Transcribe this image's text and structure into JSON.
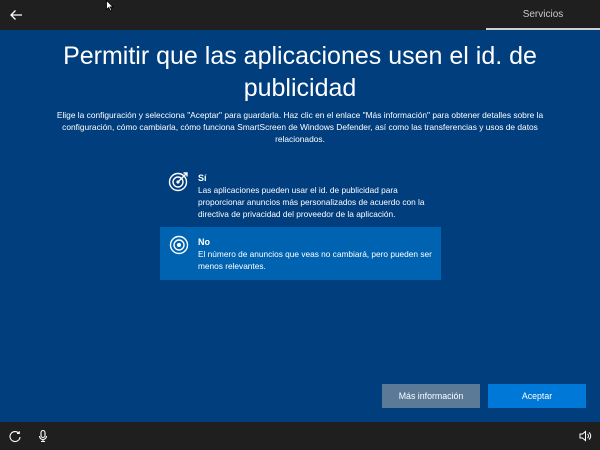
{
  "header": {
    "back_icon": "back-arrow-icon",
    "tab_label": "Servicios"
  },
  "main": {
    "title": "Permitir que las aplicaciones usen el id. de publicidad",
    "description": "Elige la configuración y selecciona \"Aceptar\" para guardarla. Haz clic en el enlace \"Más información\" para obtener detalles sobre la configuración, cómo cambiarla, cómo funciona SmartScreen de Windows Defender, así como las transferencias y usos de datos relacionados."
  },
  "options": [
    {
      "title": "Sí",
      "body": "Las aplicaciones pueden usar el id. de publicidad para proporcionar anuncios más personalizados de acuerdo con la directiva de privacidad del proveedor de la aplicación.",
      "icon": "target-icon",
      "selected": false
    },
    {
      "title": "No",
      "body": "El número de anuncios que veas no cambiará, pero pueden ser menos relevantes.",
      "icon": "radio-target-icon",
      "selected": true
    }
  ],
  "buttons": {
    "more_info": "Más información",
    "accept": "Aceptar"
  },
  "footer": {
    "icons": [
      "ease-of-access-icon",
      "microphone-icon",
      "volume-icon"
    ]
  },
  "colors": {
    "background": "#003e7e",
    "selected": "#0063b1",
    "accent": "#0078d7",
    "bar": "#1f1f1f"
  }
}
